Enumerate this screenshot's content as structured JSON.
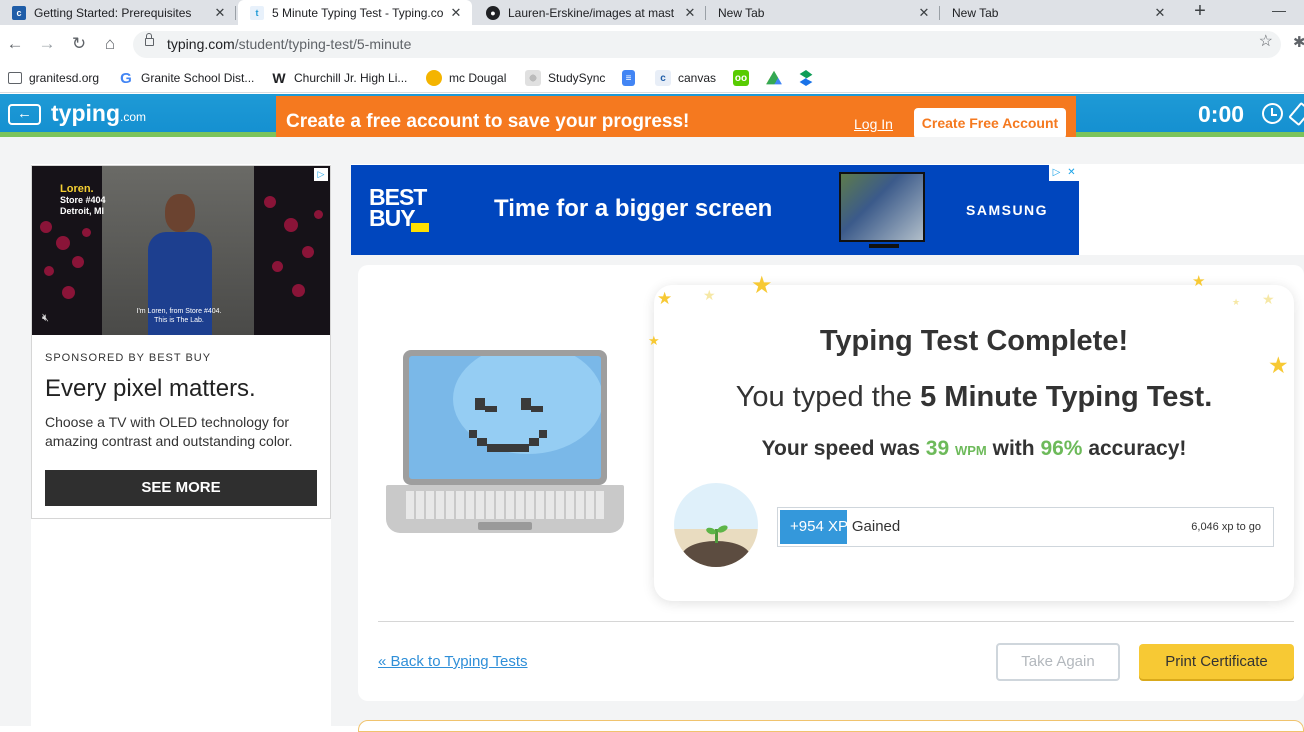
{
  "browser": {
    "tabs": [
      {
        "title": "Getting Started: Prerequisites",
        "favicon": "canvas-icon",
        "active": false
      },
      {
        "title": "5 Minute Typing Test - Typing.co",
        "favicon": "typing-icon",
        "active": true
      },
      {
        "title": "Lauren-Erskine/images at mast",
        "favicon": "github-icon",
        "active": false
      },
      {
        "title": "New Tab",
        "favicon": "",
        "active": false
      },
      {
        "title": "New Tab",
        "favicon": "",
        "active": false
      }
    ],
    "close_glyph": "✕",
    "new_tab_glyph": "+",
    "minimize_glyph": "—",
    "url_host": "typing.com",
    "url_path": "/student/typing-test/5-minute",
    "bookmarks": [
      {
        "label": "granitesd.org",
        "icon": "folder-icon",
        "color": "#5f6368"
      },
      {
        "label": "Granite School Dist...",
        "icon": "google-icon",
        "color": "#4285f4"
      },
      {
        "label": "Churchill Jr. High Li...",
        "icon": "w-icon",
        "color": "#202124"
      },
      {
        "label": "mc Dougal",
        "icon": "circle-icon",
        "color": "#f4b400"
      },
      {
        "label": "StudySync",
        "icon": "studysync-icon",
        "color": "#9e9e9e"
      },
      {
        "label": "",
        "icon": "docs-icon",
        "color": "#4285f4"
      },
      {
        "label": "canvas",
        "icon": "canvas-icon",
        "color": "#1f5da8"
      },
      {
        "label": "",
        "icon": "duolingo-icon",
        "color": "#58cc02"
      },
      {
        "label": "",
        "icon": "drive-icon",
        "color": "#34a853"
      },
      {
        "label": "",
        "icon": "app-icon",
        "color": "#0f9d58"
      }
    ]
  },
  "site": {
    "logo": "typing",
    "logo_suffix": ".com",
    "timer": "0:00",
    "promo_message": "Create a free account to save your progress!",
    "login_label": "Log In",
    "create_account_label": "Create Free Account"
  },
  "left_ad": {
    "video_name": "Loren.",
    "video_store": "Store #404",
    "video_city": "Detroit, MI",
    "video_caption": "I'm Loren, from Store #404. This is The Lab.",
    "sponsored": "SPONSORED BY BEST BUY",
    "headline": "Every pixel matters.",
    "body": "Choose a TV with OLED technology for amazing contrast and outstanding color.",
    "cta": "SEE MORE"
  },
  "banner_ad": {
    "brand_line1": "BEST",
    "brand_line2": "BUY",
    "headline": "Time for a bigger screen",
    "partner": "SAMSUNG"
  },
  "results": {
    "title": "Typing Test Complete!",
    "typed_prefix": "You typed the",
    "test_name": "5 Minute Typing Test.",
    "speed_prefix": "Your speed was",
    "wpm": "39",
    "wpm_unit": "WPM",
    "speed_mid": "with",
    "accuracy": "96%",
    "speed_suffix": "accuracy!",
    "xp_gained": "+954 XP",
    "xp_gained_suffix": "Gained",
    "xp_to_go": "6,046 xp to go",
    "xp_progress_fraction": 0.137
  },
  "footer": {
    "back_link": "« Back to Typing Tests",
    "take_again": "Take Again",
    "print_certificate": "Print Certificate"
  }
}
